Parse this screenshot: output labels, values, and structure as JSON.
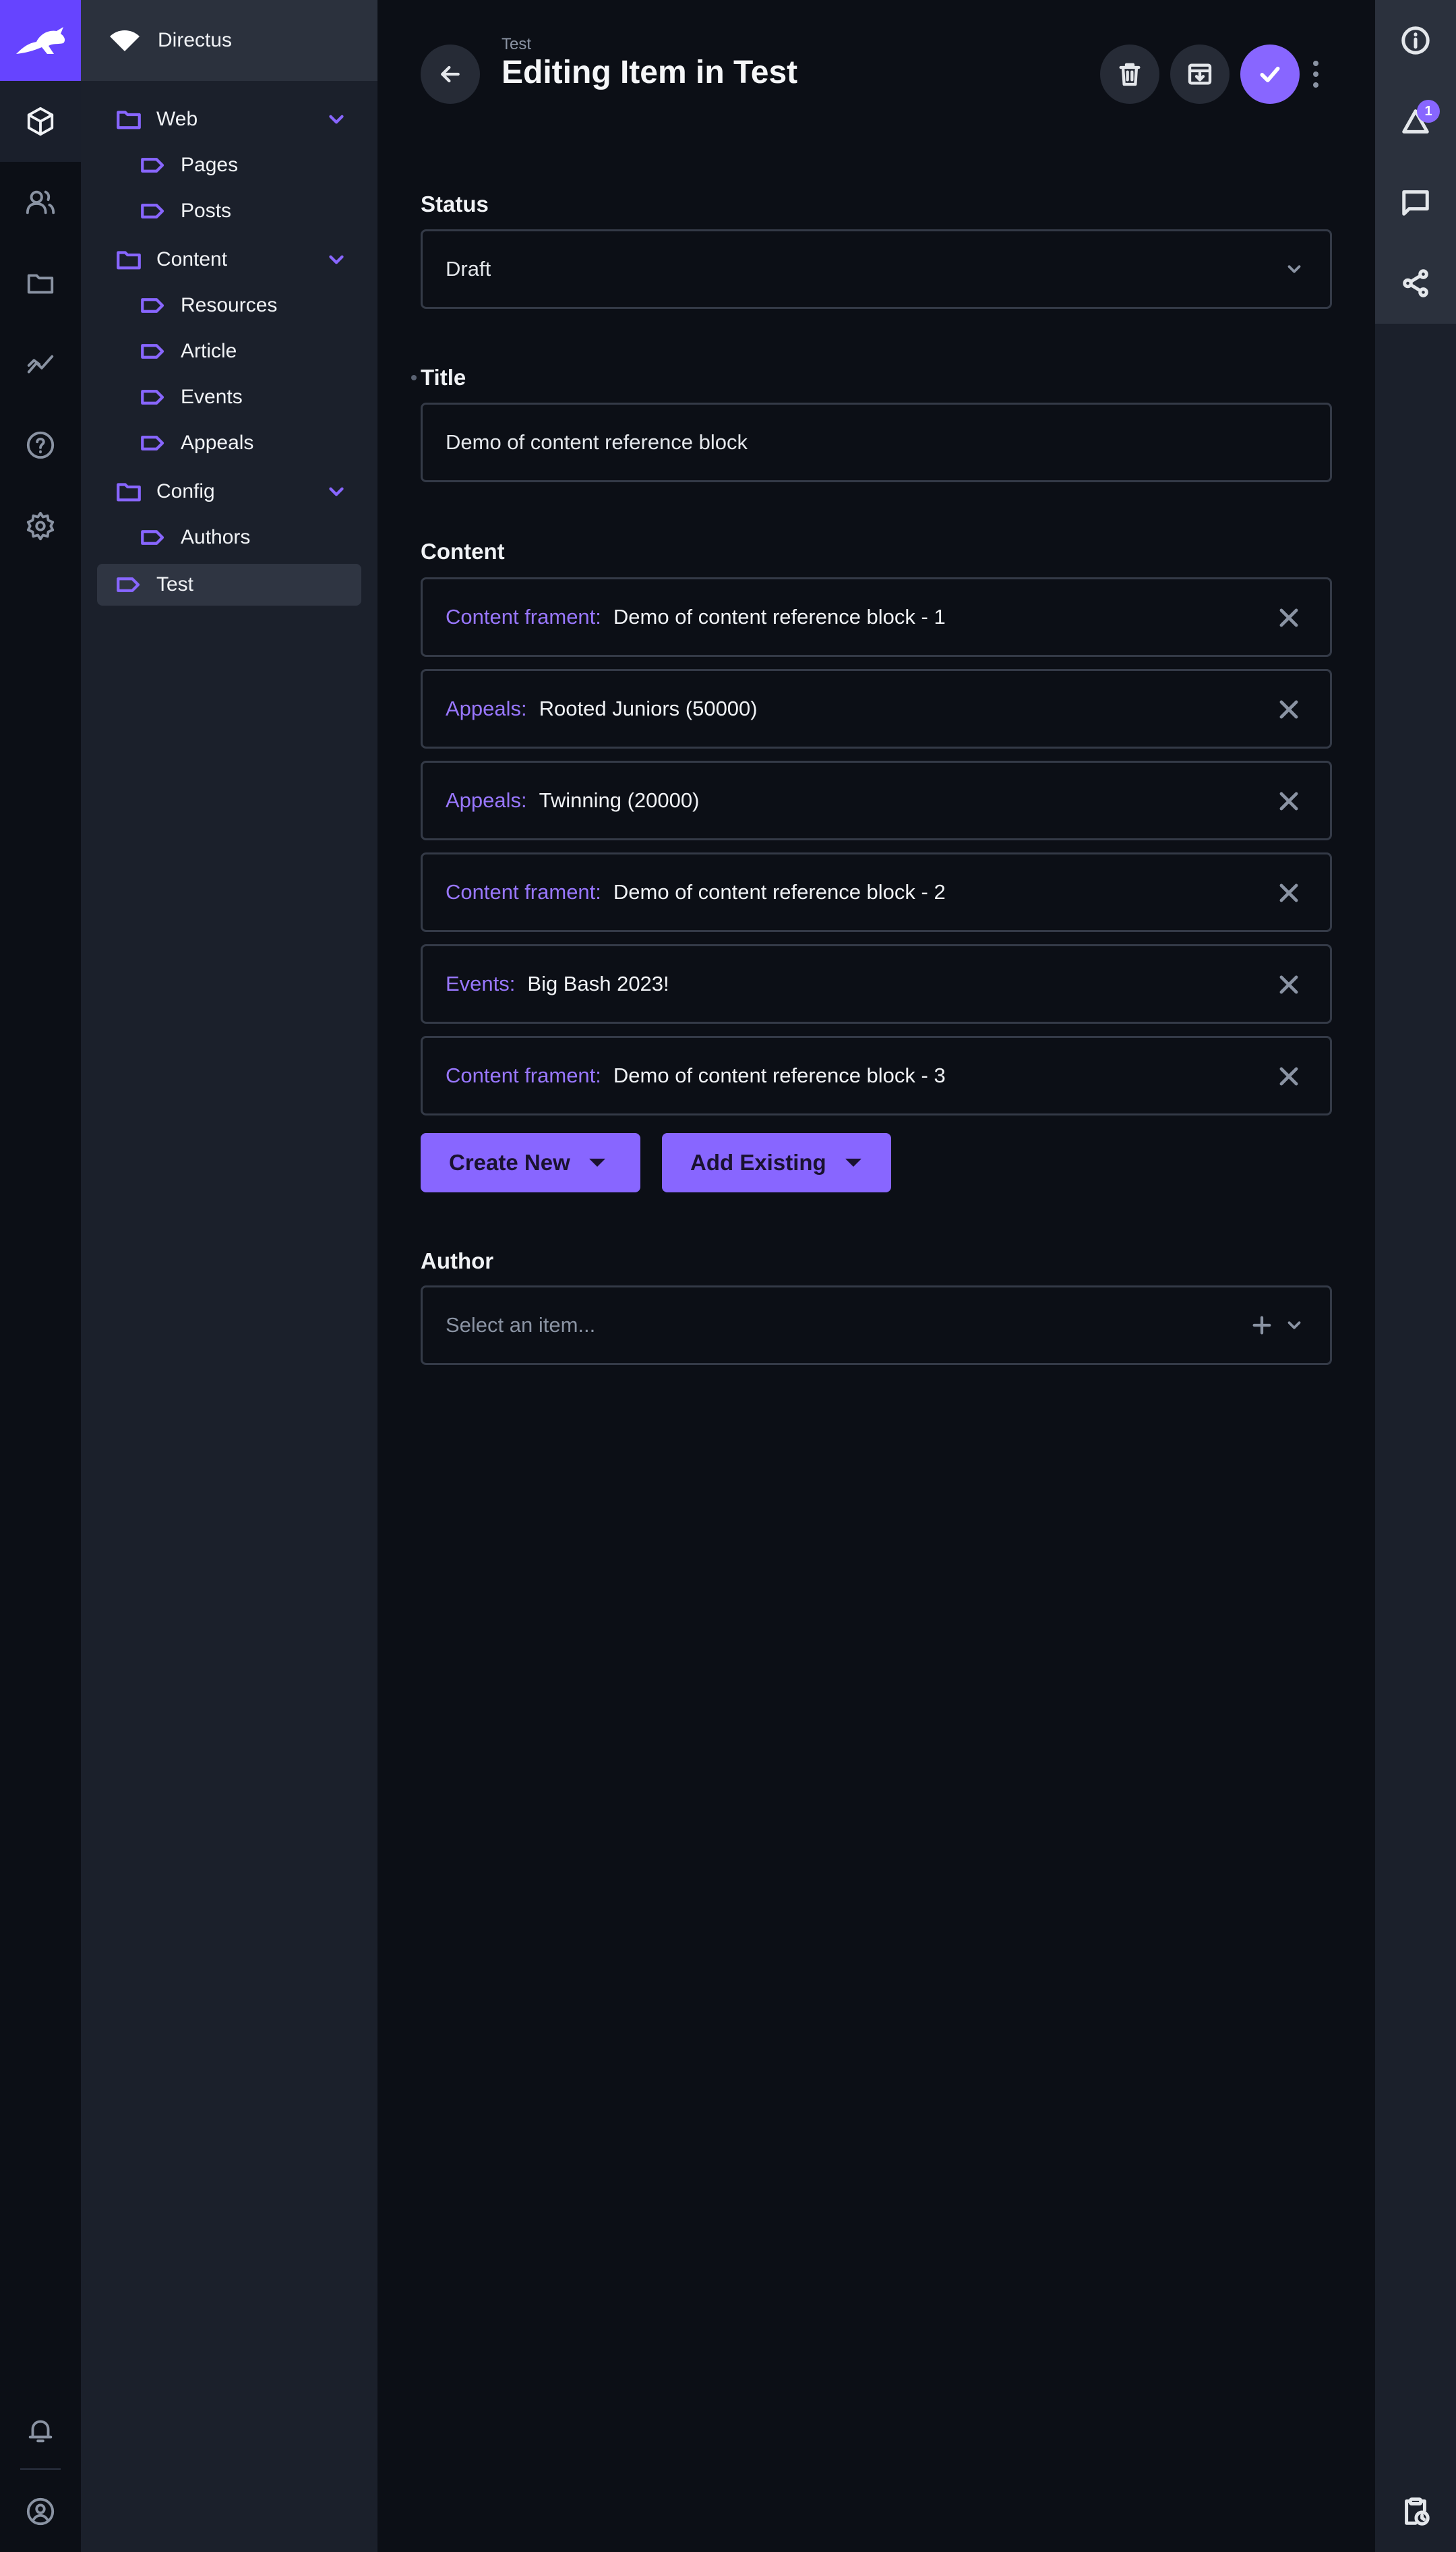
{
  "project": {
    "name": "Directus"
  },
  "nav": {
    "items": [
      {
        "label": "Web",
        "type": "folder"
      },
      {
        "label": "Pages",
        "type": "collection"
      },
      {
        "label": "Posts",
        "type": "collection"
      },
      {
        "label": "Content",
        "type": "folder"
      },
      {
        "label": "Resources",
        "type": "collection"
      },
      {
        "label": "Article",
        "type": "collection"
      },
      {
        "label": "Events",
        "type": "collection"
      },
      {
        "label": "Appeals",
        "type": "collection"
      },
      {
        "label": "Config",
        "type": "folder"
      },
      {
        "label": "Authors",
        "type": "collection"
      },
      {
        "label": "Test",
        "type": "collection",
        "active": true
      }
    ]
  },
  "header": {
    "breadcrumb": "Test",
    "title": "Editing Item in Test"
  },
  "form": {
    "status": {
      "label": "Status",
      "value": "Draft"
    },
    "title": {
      "label": "Title",
      "value": "Demo of content reference block"
    },
    "content": {
      "label": "Content",
      "items": [
        {
          "collection": "Content frament:",
          "value": "Demo of content reference block - 1"
        },
        {
          "collection": "Appeals:",
          "value": "Rooted Juniors (50000)"
        },
        {
          "collection": "Appeals:",
          "value": "Twinning (20000)"
        },
        {
          "collection": "Content frament:",
          "value": "Demo of content reference block - 2"
        },
        {
          "collection": "Events:",
          "value": "Big Bash 2023!"
        },
        {
          "collection": "Content frament:",
          "value": "Demo of content reference block - 3"
        }
      ],
      "create_new_label": "Create New",
      "add_existing_label": "Add Existing"
    },
    "author": {
      "label": "Author",
      "placeholder": "Select an item..."
    }
  },
  "sidebar": {
    "revisions_badge": "1"
  },
  "colors": {
    "accent": "#8866ff",
    "background": "#0c0f16",
    "nav": "#1b202b"
  }
}
